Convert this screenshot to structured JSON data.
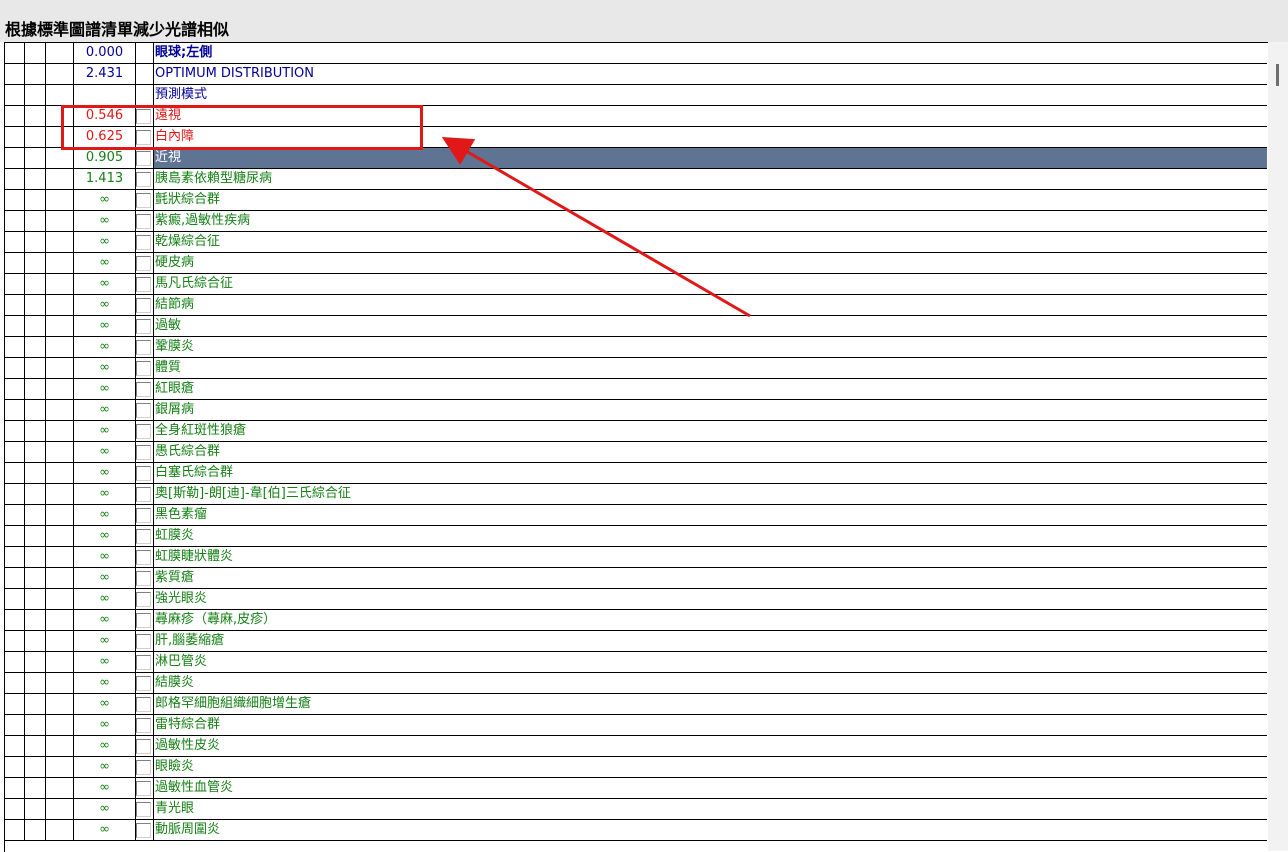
{
  "window": {
    "title": "根據標準圖譜清單減少光譜相似"
  },
  "colors": {
    "header_blue": "#000099",
    "annot_red": "#e11818",
    "green": "#158015",
    "selected_bg": "#5f7393"
  },
  "rows": [
    {
      "value": "0.000",
      "label": "眼球;左側",
      "style": "header-bold",
      "checkbox": false
    },
    {
      "value": "2.431",
      "label": "OPTIMUM DISTRIBUTION",
      "style": "header",
      "checkbox": false
    },
    {
      "value": "",
      "label": "預測模式",
      "style": "header",
      "checkbox": false
    },
    {
      "value": "0.546",
      "label": "遠視",
      "style": "red",
      "checkbox": true
    },
    {
      "value": "0.625",
      "label": "白內障",
      "style": "red",
      "checkbox": true
    },
    {
      "value": "0.905",
      "label": "近視",
      "style": "selected",
      "checkbox": true
    },
    {
      "value": "1.413",
      "label": "胰島素依賴型糖尿病",
      "style": "green",
      "checkbox": true
    },
    {
      "value": "∞",
      "label": "氈狀綜合群",
      "style": "green",
      "checkbox": true
    },
    {
      "value": "∞",
      "label": "紫癜,過敏性疾病",
      "style": "green",
      "checkbox": true
    },
    {
      "value": "∞",
      "label": "乾燥綜合征",
      "style": "green",
      "checkbox": true
    },
    {
      "value": "∞",
      "label": "硬皮病",
      "style": "green",
      "checkbox": true
    },
    {
      "value": "∞",
      "label": "馬凡氏綜合征",
      "style": "green",
      "checkbox": true
    },
    {
      "value": "∞",
      "label": "結節病",
      "style": "green",
      "checkbox": true
    },
    {
      "value": "∞",
      "label": "過敏",
      "style": "green",
      "checkbox": true
    },
    {
      "value": "∞",
      "label": "鞏膜炎",
      "style": "green",
      "checkbox": true
    },
    {
      "value": "∞",
      "label": "體質",
      "style": "green",
      "checkbox": true
    },
    {
      "value": "∞",
      "label": "紅眼瘡",
      "style": "green",
      "checkbox": true
    },
    {
      "value": "∞",
      "label": "銀屑病",
      "style": "green",
      "checkbox": true
    },
    {
      "value": "∞",
      "label": "全身紅斑性狼瘡",
      "style": "green",
      "checkbox": true
    },
    {
      "value": "∞",
      "label": "愚氏綜合群",
      "style": "green",
      "checkbox": true
    },
    {
      "value": "∞",
      "label": "白塞氏綜合群",
      "style": "green",
      "checkbox": true
    },
    {
      "value": "∞",
      "label": "奧[斯勒]-朗[迪]-韋[伯]三氏綜合征",
      "style": "green",
      "checkbox": true
    },
    {
      "value": "∞",
      "label": "黑色素瘤",
      "style": "green",
      "checkbox": true
    },
    {
      "value": "∞",
      "label": "虹膜炎",
      "style": "green",
      "checkbox": true
    },
    {
      "value": "∞",
      "label": "虹膜睫狀體炎",
      "style": "green",
      "checkbox": true
    },
    {
      "value": "∞",
      "label": "紫質瘡",
      "style": "green",
      "checkbox": true
    },
    {
      "value": "∞",
      "label": "強光眼炎",
      "style": "green",
      "checkbox": true
    },
    {
      "value": "∞",
      "label": "蕁麻疹（蕁麻,皮疹）",
      "style": "green",
      "checkbox": true
    },
    {
      "value": "∞",
      "label": "肝,腦萎縮瘡",
      "style": "green",
      "checkbox": true
    },
    {
      "value": "∞",
      "label": "淋巴管炎",
      "style": "green",
      "checkbox": true
    },
    {
      "value": "∞",
      "label": "結膜炎",
      "style": "green",
      "checkbox": true
    },
    {
      "value": "∞",
      "label": "郎格罕細胞組織細胞增生瘡",
      "style": "green",
      "checkbox": true
    },
    {
      "value": "∞",
      "label": "雷特綜合群",
      "style": "green",
      "checkbox": true
    },
    {
      "value": "∞",
      "label": "過敏性皮炎",
      "style": "green",
      "checkbox": true
    },
    {
      "value": "∞",
      "label": "眼瞼炎",
      "style": "green",
      "checkbox": true
    },
    {
      "value": "∞",
      "label": "過敏性血管炎",
      "style": "green",
      "checkbox": true
    },
    {
      "value": "∞",
      "label": "青光眼",
      "style": "green",
      "checkbox": true
    },
    {
      "value": "∞",
      "label": "動脈周圍炎",
      "style": "green",
      "checkbox": true
    }
  ]
}
